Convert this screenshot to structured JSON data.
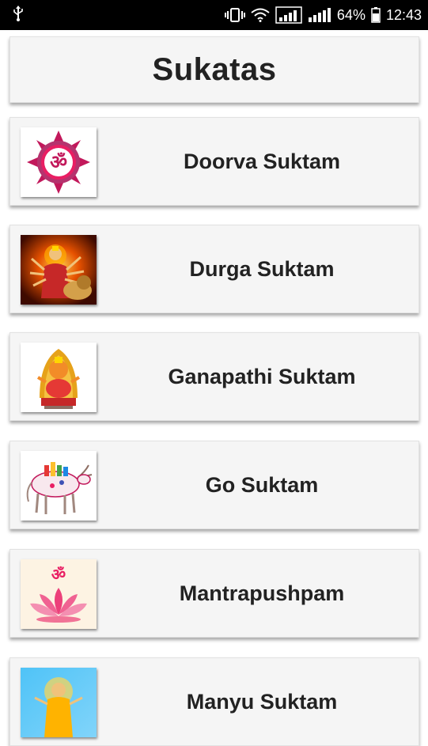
{
  "status_bar": {
    "battery_percent": "64%",
    "time": "12:43",
    "icons": [
      "usb-icon",
      "vibrate-icon",
      "wifi-icon",
      "signal-icon",
      "signal-icon",
      "battery-icon"
    ]
  },
  "header": {
    "title": "Sukatas"
  },
  "items": [
    {
      "label": "Doorva Suktam",
      "icon": "om-mandala-icon"
    },
    {
      "label": "Durga Suktam",
      "icon": "durga-image"
    },
    {
      "label": "Ganapathi Suktam",
      "icon": "ganesha-image"
    },
    {
      "label": "Go Suktam",
      "icon": "cow-image"
    },
    {
      "label": "Mantrapushpam",
      "icon": "om-lotus-icon"
    },
    {
      "label": "Manyu Suktam",
      "icon": "deity-image"
    }
  ],
  "colors": {
    "status_bar": "#000000",
    "card": "#f5f5f5",
    "text": "#222222"
  }
}
